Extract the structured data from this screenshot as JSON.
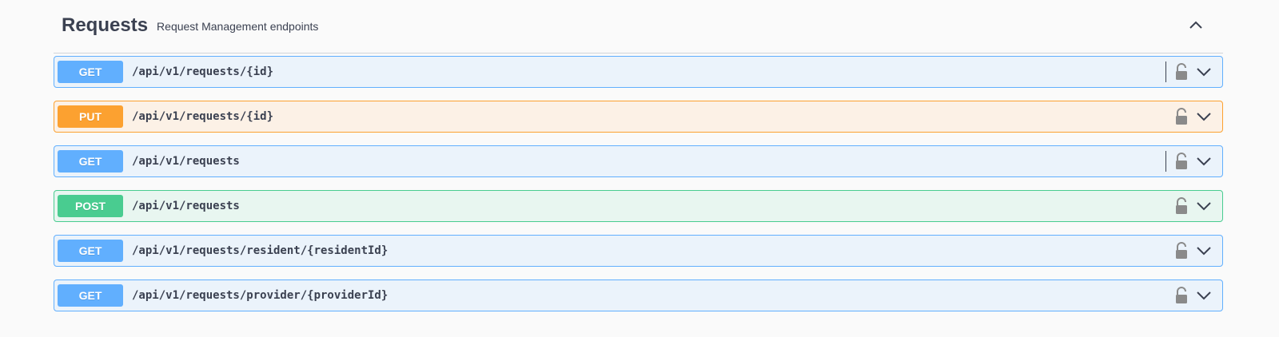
{
  "section": {
    "title": "Requests",
    "description": "Request Management endpoints",
    "collapse_icon": "chevron-up-icon"
  },
  "operations": [
    {
      "method": "GET",
      "path": "/api/v1/requests/{id}",
      "kind": "get",
      "divider": true
    },
    {
      "method": "PUT",
      "path": "/api/v1/requests/{id}",
      "kind": "put",
      "divider": false
    },
    {
      "method": "GET",
      "path": "/api/v1/requests",
      "kind": "get",
      "divider": true
    },
    {
      "method": "POST",
      "path": "/api/v1/requests",
      "kind": "post",
      "divider": false
    },
    {
      "method": "GET",
      "path": "/api/v1/requests/resident/{residentId}",
      "kind": "get",
      "divider": false
    },
    {
      "method": "GET",
      "path": "/api/v1/requests/provider/{providerId}",
      "kind": "get",
      "divider": false
    }
  ],
  "colors": {
    "get": "#61affe",
    "put": "#fca130",
    "post": "#49cc90",
    "text": "#3b4151"
  },
  "icons": {
    "lock": "unlocked-padlock-icon",
    "expand": "chevron-down-icon"
  }
}
